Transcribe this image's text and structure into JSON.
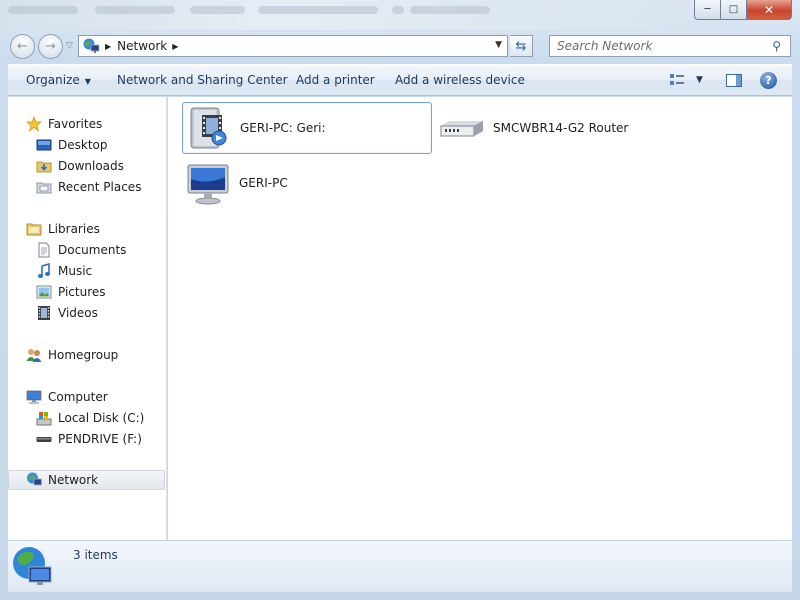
{
  "window": {
    "caption_buttons": {
      "minimize": "minimize-icon",
      "maximize": "maximize-icon",
      "close": "close-icon"
    }
  },
  "address_bar": {
    "crumbs": [
      "Network"
    ],
    "icons": [
      "back-icon",
      "forward-icon",
      "network-icon",
      "refresh-icon"
    ]
  },
  "search": {
    "placeholder": "Search Network"
  },
  "toolbar": {
    "organize": "Organize",
    "network_sharing": "Network and Sharing Center",
    "add_printer": "Add a printer",
    "add_wireless": "Add a wireless device"
  },
  "sidebar": {
    "favorites": {
      "label": "Favorites",
      "items": [
        "Desktop",
        "Downloads",
        "Recent Places"
      ]
    },
    "libraries": {
      "label": "Libraries",
      "items": [
        "Documents",
        "Music",
        "Pictures",
        "Videos"
      ]
    },
    "homegroup": {
      "label": "Homegroup"
    },
    "computer": {
      "label": "Computer",
      "items": [
        "Local Disk (C:)",
        "PENDRIVE (F:)"
      ]
    },
    "network": {
      "label": "Network"
    }
  },
  "content": {
    "items": [
      {
        "label": "GERI-PC: Geri:",
        "icon": "media-server-icon"
      },
      {
        "label": "SMCWBR14-G2 Router",
        "icon": "router-icon"
      },
      {
        "label": "GERI-PC",
        "icon": "computer-icon"
      }
    ]
  },
  "status": {
    "count": "3 items"
  },
  "colors": {
    "accent": "#1e395b",
    "selection_border": "#7da2ce",
    "close_red": "#c7462d"
  }
}
